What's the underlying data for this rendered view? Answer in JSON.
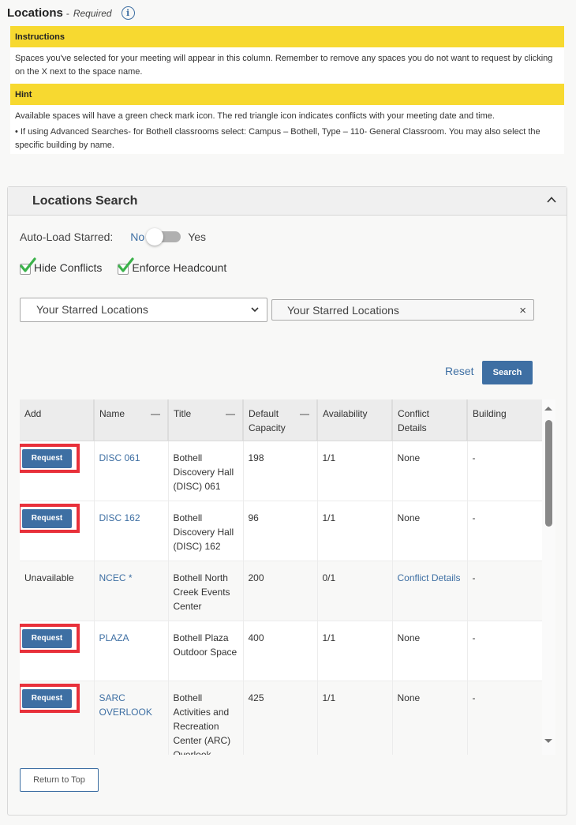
{
  "header": {
    "title": "Locations",
    "separator": "-",
    "required_label": "Required",
    "info_icon": "info-icon"
  },
  "instructions": {
    "heading": "Instructions",
    "text": "Spaces you've selected for your meeting will appear in this column. Remember to remove any spaces you do not want to request by clicking on the X next to the space name."
  },
  "hint": {
    "heading": "Hint",
    "text": "Available spaces will have a green check mark icon. The red triangle icon indicates conflicts with your meeting date and time.",
    "bullet": "•   If using Advanced Searches- for Bothell classrooms select: Campus – Bothell, Type – 110- General Classroom. You may also select the specific building by name."
  },
  "search_panel": {
    "title": "Locations Search",
    "collapse_icon": "chevron-up-icon",
    "auto_load": {
      "label": "Auto-Load Starred:",
      "off_label": "No",
      "on_label": "Yes",
      "value": false
    },
    "checkboxes": [
      {
        "label": "Hide Conflicts",
        "checked": true
      },
      {
        "label": "Enforce Headcount",
        "checked": true
      }
    ],
    "select": {
      "value": "Your Starred Locations"
    },
    "token": {
      "value": "Your Starred Locations",
      "clear_icon": "×"
    },
    "reset_label": "Reset",
    "search_label": "Search"
  },
  "grid": {
    "columns": [
      {
        "label": "Add",
        "sortable": false
      },
      {
        "label": "Name",
        "sortable": true
      },
      {
        "label": "Title",
        "sortable": true
      },
      {
        "label": "Default Capacity",
        "sortable": true
      },
      {
        "label": "Availability",
        "sortable": false
      },
      {
        "label": "Conflict Details",
        "sortable": false
      },
      {
        "label": "Building",
        "sortable": false
      }
    ],
    "sort_indicator": "—",
    "rows": [
      {
        "add": "Request",
        "name": "DISC 061",
        "title": "Bothell Discovery Hall (DISC) 061",
        "capacity": "198",
        "availability": "1/1",
        "conflict": "None",
        "building": "-"
      },
      {
        "add": "Request",
        "name": "DISC 162",
        "title": "Bothell Discovery Hall (DISC) 162",
        "capacity": "96",
        "availability": "1/1",
        "conflict": "None",
        "building": "-"
      },
      {
        "add": "Unavailable",
        "name": "NCEC *",
        "title": "Bothell North Creek Events Center",
        "capacity": "200",
        "availability": "0/1",
        "conflict": "Conflict Details",
        "building": "-"
      },
      {
        "add": "Request",
        "name": "PLAZA",
        "title": "Bothell Plaza Outdoor Space",
        "capacity": "400",
        "availability": "1/1",
        "conflict": "None",
        "building": "-"
      },
      {
        "add": "Request",
        "name": "SARC OVERLOOK",
        "title": "Bothell Activities and Recreation Center (ARC) Overlook",
        "capacity": "425",
        "availability": "1/1",
        "conflict": "None",
        "building": "-"
      }
    ]
  },
  "return_to_top_label": "Return to Top",
  "colors": {
    "accent": "#3e6fa3",
    "banner": "#f7d930",
    "highlight": "#e8303a",
    "check": "#3bb24a"
  }
}
